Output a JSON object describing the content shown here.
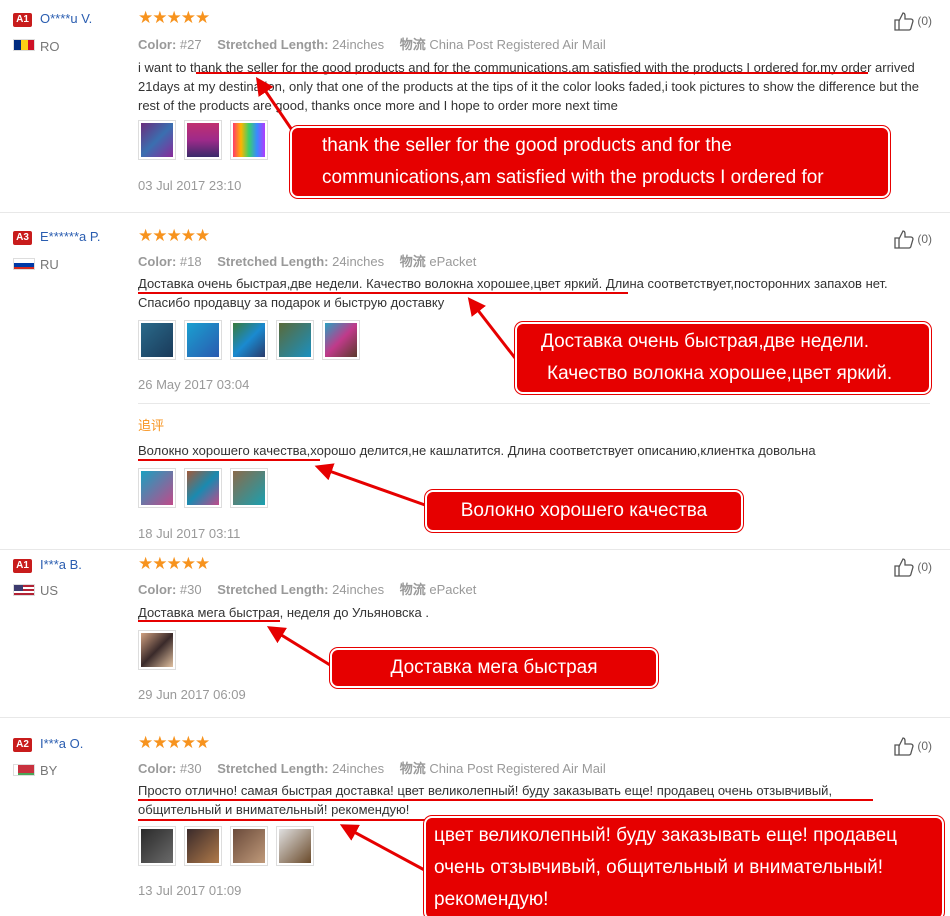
{
  "reviews": [
    {
      "badge": "A1",
      "user": "O****u V.",
      "country": "RO",
      "stars": "★★★★★",
      "color_label": "Color:",
      "color": "#27",
      "length_label": "Stretched Length:",
      "length": "24inches",
      "ship_label": "物流",
      "ship": "China Post Registered Air Mail",
      "text": "i want to thank the seller for the good products and for the communications,am satisfied with the products I ordered for,my order arrived 21days at my destination, only that one of the products at the tips of it the color looks faded,i took pictures to show the difference but the rest of the products are good, thanks once more and I hope to order more next time",
      "date": "03 Jul 2017 23:10",
      "helpful": "(0)",
      "callout": "thank the seller for the good products and for the communications,am satisfied with the products I ordered for"
    },
    {
      "badge": "A3",
      "user": "E******a P.",
      "country": "RU",
      "stars": "★★★★★",
      "color_label": "Color:",
      "color": "#18",
      "length_label": "Stretched Length:",
      "length": "24inches",
      "ship_label": "物流",
      "ship": "ePacket",
      "text": "Доставка очень быстрая,две недели. Качество волокна хорошее,цвет яркий. Длина соответствует,посторонних запахов нет. Спасибо продавцу за подарок и быструю доставку",
      "date": "26 May 2017 03:04",
      "helpful": "(0)",
      "callout_line1": "Доставка очень быстрая,две недели.",
      "callout_line2": "Качество волокна хорошее,цвет яркий.",
      "followup_label": "追评",
      "followup_text": "Волокно хорошего качества,хорошо делится,не кашлатится. Длина соответствует описанию,клиентка довольна",
      "followup_date": "18 Jul 2017 03:11",
      "followup_callout": "Волокно хорошего качества"
    },
    {
      "badge": "A1",
      "user": "I***a B.",
      "country": "US",
      "stars": "★★★★★",
      "color_label": "Color:",
      "color": "#30",
      "length_label": "Stretched Length:",
      "length": "24inches",
      "ship_label": "物流",
      "ship": "ePacket",
      "text": "Доставка мега быстрая, неделя до Ульяновска .",
      "date": "29 Jun 2017 06:09",
      "helpful": "(0)",
      "callout": "Доставка мега быстрая"
    },
    {
      "badge": "A2",
      "user": "I***a O.",
      "country": "BY",
      "stars": "★★★★★",
      "color_label": "Color:",
      "color": "#30",
      "length_label": "Stretched Length:",
      "length": "24inches",
      "ship_label": "物流",
      "ship": "China Post Registered Air Mail",
      "text": "Просто отлично! самая быстрая доставка! цвет великолепный! буду заказывать еще! продавец очень отзывчивый, общительный и внимательный! рекомендую!",
      "date": "13 Jul 2017 01:09",
      "helpful": "(0)",
      "callout": "цвет великолепный! буду заказывать еще! продавец очень отзывчивый, общительный и внимательный! рекомендую!"
    }
  ],
  "colors": {
    "accent": "#e60000",
    "star": "#f7931e",
    "username": "#2a5db0",
    "badge": "#c81c1c"
  }
}
